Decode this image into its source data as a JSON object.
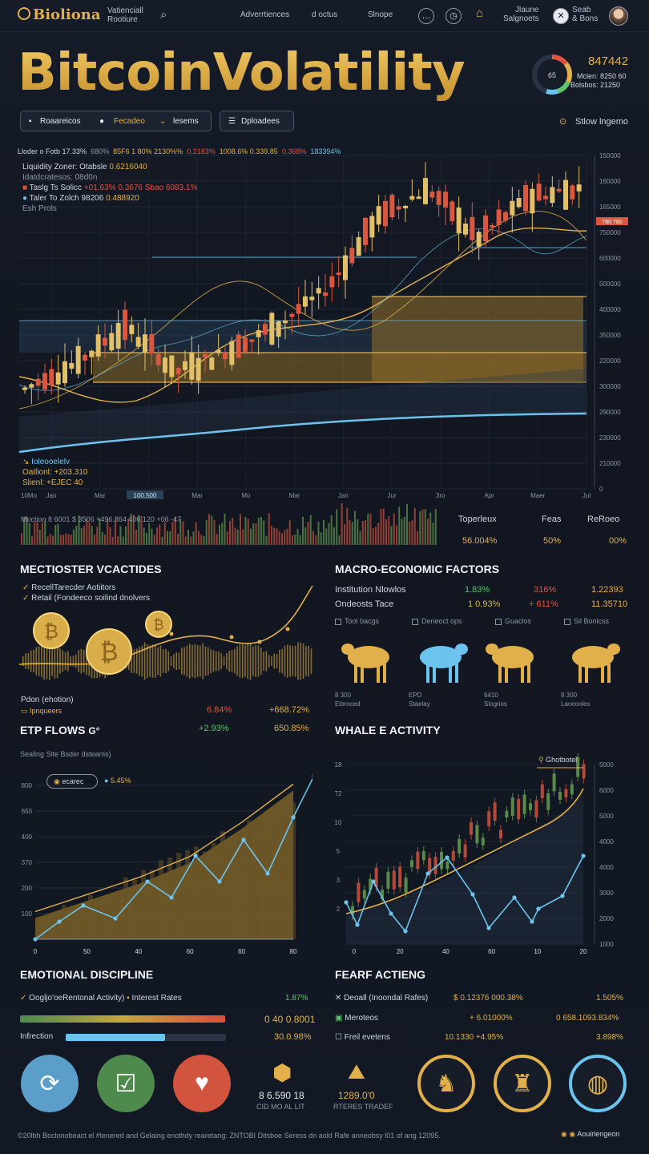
{
  "nav": {
    "logo": "Bioliona",
    "subtitle_1": "Vatienciall",
    "subtitle_2": "Rootiure",
    "links": [
      "Adverrtiences",
      "d octus",
      "Slnope"
    ],
    "right_1a": "Jlaune",
    "right_1b": "Salgnoets",
    "right_2a": "Seab",
    "right_2b": "& Bons"
  },
  "hero": {
    "title": "BitcoinVolatility",
    "gauge_value": "847442",
    "gauge_center": "65",
    "gauge_sub1": "Mclen: 8250 60",
    "gauge_sub2": "Bolsbos: 21250"
  },
  "filters": {
    "pill1_a": "Roaareicos",
    "pill1_b": "Fecadeo",
    "pill1_c": "lesems",
    "pill2": "Dploadees",
    "right": "Stlow lngemo"
  },
  "main_chart": {
    "legend_line": [
      "Lloder o Fotb 17.33%",
      "680%",
      "85F6 1 80% 2130%%",
      "0.2183%",
      "1008.6% 0.339.85",
      "0.368%",
      "183394%"
    ],
    "info": [
      {
        "label": "Liquidity Zoner: Otabsle",
        "value": "0.6216040"
      },
      {
        "label": "Idatdcratesos: 08d0n",
        "value": ""
      },
      {
        "label": "Taslg Ts Solicc",
        "value": "+01.63% 0.3676 Sbao 6083.1%"
      },
      {
        "label": "Taler To Zolch 98206",
        "value": "0.488920"
      },
      {
        "label": "Esh Prols",
        "value": ""
      }
    ],
    "y_ticks": [
      "150000",
      "160000",
      "165000",
      "750000",
      "600000",
      "500000",
      "400000",
      "350000",
      "220000",
      "300000",
      "290000",
      "230000",
      "210000",
      "0"
    ],
    "price_tag": "780 780",
    "x_ticks": [
      "Jan",
      "Mar",
      "Jan",
      "Mar",
      "Mo",
      "Mar",
      "Jan",
      "Jur",
      "3ro",
      "Apr",
      "Maer",
      "Jul"
    ],
    "x_start": "10Mo",
    "x_highlight": "100.500",
    "bottom_left": [
      "Ioleooelelv",
      "Oatlionl: +203.310",
      "Slienl: +EJEC 40"
    ]
  },
  "volume": {
    "label": "Moction 8 6001 $ 3506 +496.864 406 120 +06 -47",
    "headers": [
      "Toperleux",
      "Feas",
      "ReRoeo"
    ],
    "values": [
      "56.004%",
      "50%",
      "00%"
    ]
  },
  "left_panel": {
    "title": "MECTIOSTER VCACTIDES",
    "item1": "RecellTarecder Aotiitors",
    "item2": "Retail (Fondeeco soilind dnolvers",
    "caption1": "Pdon (ehotion)",
    "caption2": "Ipnqueers",
    "val1": "6.84%",
    "val2": "+668.72%"
  },
  "macro": {
    "title": "MACRO-ECONOMIC FACTORS",
    "rows": [
      {
        "label": "Institution Nlowlos",
        "v1": "1.83%",
        "v2": "316%",
        "v3": "1.22393"
      },
      {
        "label": "Ondeosts Tace",
        "v1": "1 0.93%",
        "v2": "+ 611%",
        "v3": "11.35710"
      }
    ],
    "checks": [
      "Tool bacgs",
      "Deneoct ops",
      "Guaclos",
      "Sil Bonicss"
    ],
    "animals": [
      {
        "a": "8 300",
        "b": "Eloroced",
        "color": "#e2b04a"
      },
      {
        "a": "EPD",
        "b": "Staelay",
        "color": "#6cc4ee"
      },
      {
        "a": "6410",
        "b": "Slogrios",
        "color": "#e2b04a"
      },
      {
        "a": "8 300",
        "b": "Laceooles",
        "color": "#e2b04a"
      }
    ]
  },
  "etf": {
    "title": "ETP FLOWS",
    "title_icon": "G°",
    "v1": "+2.93%",
    "v2": "650.85%",
    "sub": "Sealing Site Bsder dsteams)",
    "badge1": "ecarec",
    "badge2": "5.45%",
    "y_ticks": [
      "800",
      "650",
      "400",
      "370",
      "200",
      "100"
    ],
    "x_ticks": [
      "0",
      "50",
      "40",
      "60",
      "60",
      "80"
    ]
  },
  "whale": {
    "title": "WHALE E ACTIVITY",
    "tag": "Ghotbotel",
    "y_left": [
      "18",
      "72",
      "10",
      "5",
      "3",
      "2"
    ],
    "y_right": [
      "5000",
      "6000",
      "5000",
      "4000",
      "4000",
      "3000",
      "2000",
      "1000"
    ],
    "x_ticks": [
      "0",
      "20",
      "40",
      "60",
      "10",
      "20"
    ]
  },
  "emotional": {
    "title": "EMOTIONAL DISCIPLINE",
    "row1_a": "Oogljo'oeRentonal Activity)",
    "row1_b": "Interest Rates",
    "row1_v": "1.87%",
    "bar1_v": "0 40 0.8001",
    "row2_label": "Infrection",
    "row2_v": "30.0.98%",
    "bar2_fill": 0.62,
    "icons_caption_a": "8 6.590 18",
    "icons_caption_b": "CID MO AL LIT",
    "icon_names": [
      "sync-icon",
      "check-chart-icon",
      "heart-rate-icon",
      "box-gold-icon"
    ]
  },
  "fear": {
    "title": "FEARF ACTIENG",
    "rows": [
      {
        "label": "Deoall (Inoondal Rafes)",
        "mid": "0.12376 000.38%",
        "right": "1.505%"
      },
      {
        "label": "Meroteos",
        "mid": "+ 6.01000%",
        "right": "0 658.1093.834%"
      },
      {
        "label": "Freil evetens",
        "mid": "10.1330 +4.95%",
        "right": "3.898%"
      }
    ],
    "caption_a": "1289.0'0",
    "caption_b": "RTERES TRADEF"
  },
  "footer": {
    "text": "©20lbh Boclonobeact el #lenered and Gelaing enothdy rearetang: ZNTOBI Ditsboe Seress dn aold Rafe anneobsy l01 of ang 12095.",
    "right": "Aouirlengeon"
  },
  "colors": {
    "gold": "#e2b04a",
    "green": "#5cc56b",
    "red": "#e0533f",
    "blue": "#6cc4ee",
    "bg": "#121722"
  },
  "chart_data": [
    {
      "type": "line",
      "title": "",
      "x": [
        "Jan",
        "Mar",
        "Jan",
        "Mar",
        "Mo",
        "Mar",
        "Jan",
        "Jur",
        "3ro",
        "Apr",
        "Maer",
        "Jul"
      ],
      "series": [
        {
          "values": [
            240000,
            300000,
            390000,
            280000,
            330000,
            390000,
            480000,
            650000,
            720000,
            600000,
            700000,
            720000
          ]
        }
      ]
    },
    {
      "type": "area",
      "title": "ETP FLOWS",
      "x": [
        "0",
        "50",
        "40",
        "60",
        "60",
        "80"
      ],
      "series": [
        {
          "values": [
            100,
            180,
            260,
            360,
            520,
            700
          ]
        },
        {
          "values": [
            20,
            140,
            230,
            330,
            480,
            640
          ]
        }
      ]
    },
    {
      "type": "line",
      "title": "WHALE E ACTIVITY",
      "x": [
        "0",
        "20",
        "40",
        "60",
        "10",
        "20"
      ],
      "series": [
        {
          "values": [
            2.6,
            3.0,
            3.4,
            5.5,
            7.2,
            9.6
          ]
        },
        {
          "values": [
            2.4,
            4.0,
            5.0,
            3.5,
            6.0,
            3.4
          ]
        }
      ]
    }
  ]
}
